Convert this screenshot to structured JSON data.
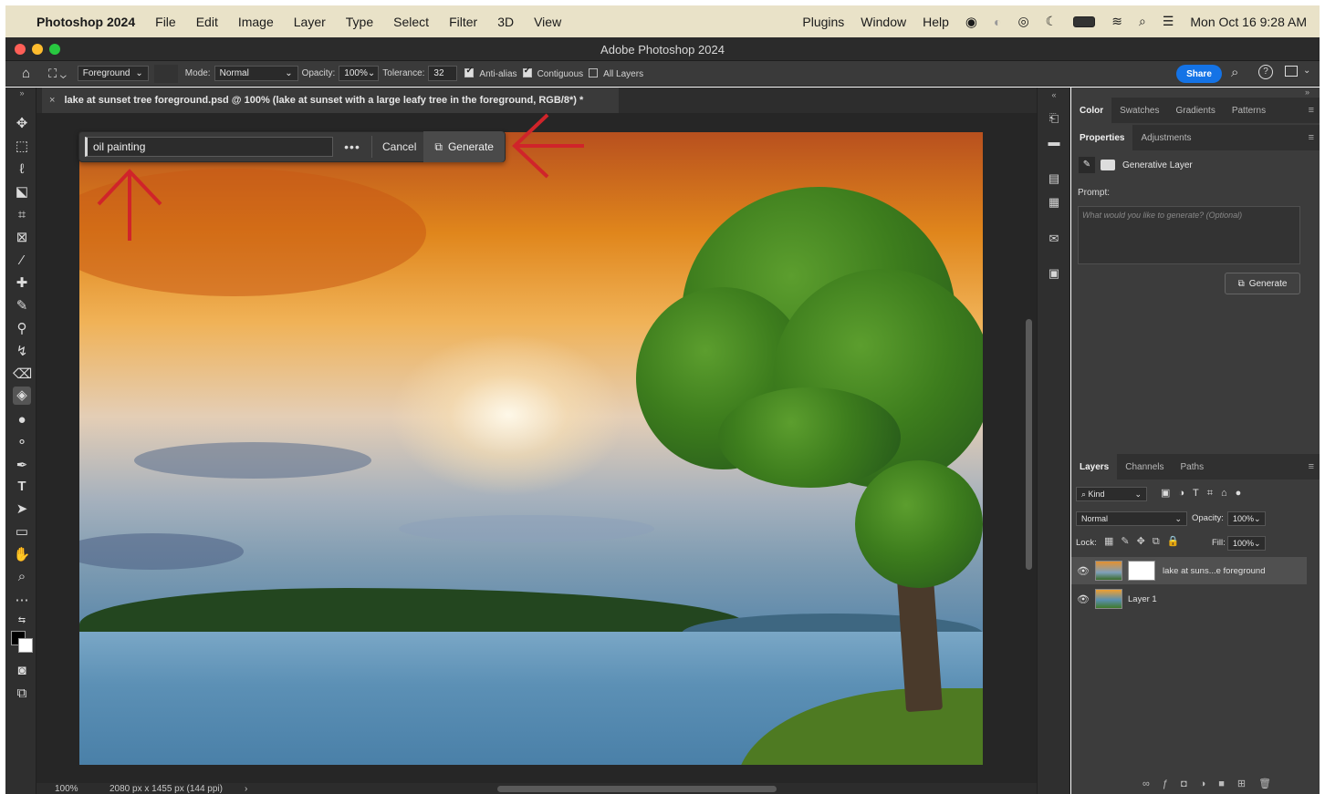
{
  "menubar": {
    "app_name": "Photoshop 2024",
    "items": [
      "File",
      "Edit",
      "Image",
      "Layer",
      "Type",
      "Select",
      "Filter",
      "3D",
      "View"
    ],
    "right_items": [
      "Plugins",
      "Window",
      "Help"
    ],
    "clock": "Mon Oct 16  9:28 AM"
  },
  "window": {
    "title": "Adobe Photoshop 2024"
  },
  "options": {
    "fill_source": "Foreground",
    "mode_label": "Mode:",
    "mode_value": "Normal",
    "opacity_label": "Opacity:",
    "opacity_value": "100%",
    "tolerance_label": "Tolerance:",
    "tolerance_value": "32",
    "anti_alias": "Anti-alias",
    "contiguous": "Contiguous",
    "all_layers": "All Layers",
    "share": "Share"
  },
  "document": {
    "tab_title": "lake at sunset tree foreground.psd @ 100% (lake at sunset with a large leafy tree in the foreground, RGB/8*) *",
    "close_glyph": "×"
  },
  "genbar": {
    "prompt_value": "oil painting",
    "more": "•••",
    "cancel": "Cancel",
    "generate": "Generate"
  },
  "status": {
    "zoom": "100%",
    "doc_info": "2080 px x 1455 px (144 ppi)",
    "chevron": "›"
  },
  "panels": {
    "top_tabs": [
      "Color",
      "Swatches",
      "Gradients",
      "Patterns"
    ],
    "prop_tabs": [
      "Properties",
      "Adjustments"
    ],
    "layer_type": "Generative Layer",
    "prompt_label": "Prompt:",
    "prompt_placeholder": "What would you like to generate? (Optional)",
    "generate": "Generate",
    "layer_tabs": [
      "Layers",
      "Channels",
      "Paths"
    ],
    "kind": "Kind",
    "blend": "Normal",
    "opacity_label": "Opacity:",
    "opacity_value": "100%",
    "lock_label": "Lock:",
    "fill_label": "Fill:",
    "fill_value": "100%",
    "layers": [
      {
        "name": "lake at suns...e foreground",
        "selected": true
      },
      {
        "name": "Layer 1",
        "selected": false
      }
    ]
  },
  "colors": {
    "accent": "#1473e6",
    "arrow": "#d0242a"
  },
  "icons": {
    "apple": "apple-icon",
    "share_search": "search-icon",
    "help": "help-icon"
  }
}
